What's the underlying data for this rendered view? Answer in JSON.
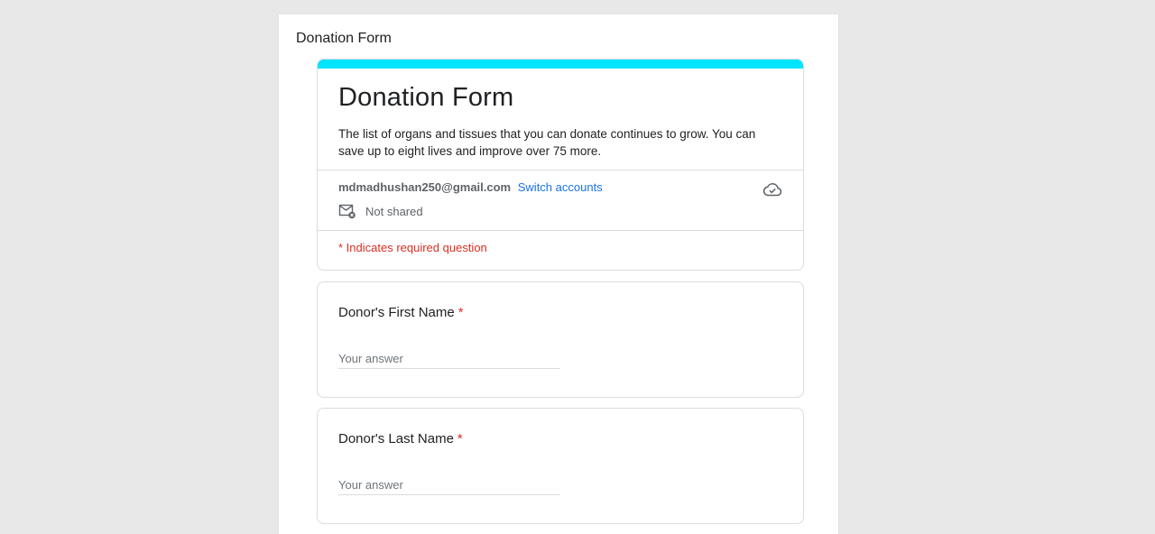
{
  "page": {
    "doc_title": "Donation Form"
  },
  "header": {
    "title": "Donation Form",
    "description": "The list of organs and tissues that you can donate continues to grow. You can save up to eight lives and improve over 75 more.",
    "accent_color": "#00e5ff"
  },
  "account": {
    "email": "mdmadhushan250@gmail.com",
    "switch_label": "Switch accounts",
    "shared_status": "Not shared",
    "cloud_icon": "cloud-saved-icon",
    "mail_icon": "mail-not-shared-icon"
  },
  "required_note": "* Indicates required question",
  "questions": [
    {
      "label": "Donor's First Name",
      "required_mark": "*",
      "placeholder": "Your answer",
      "value": ""
    },
    {
      "label": "Donor's Last Name",
      "required_mark": "*",
      "placeholder": "Your answer",
      "value": ""
    }
  ]
}
